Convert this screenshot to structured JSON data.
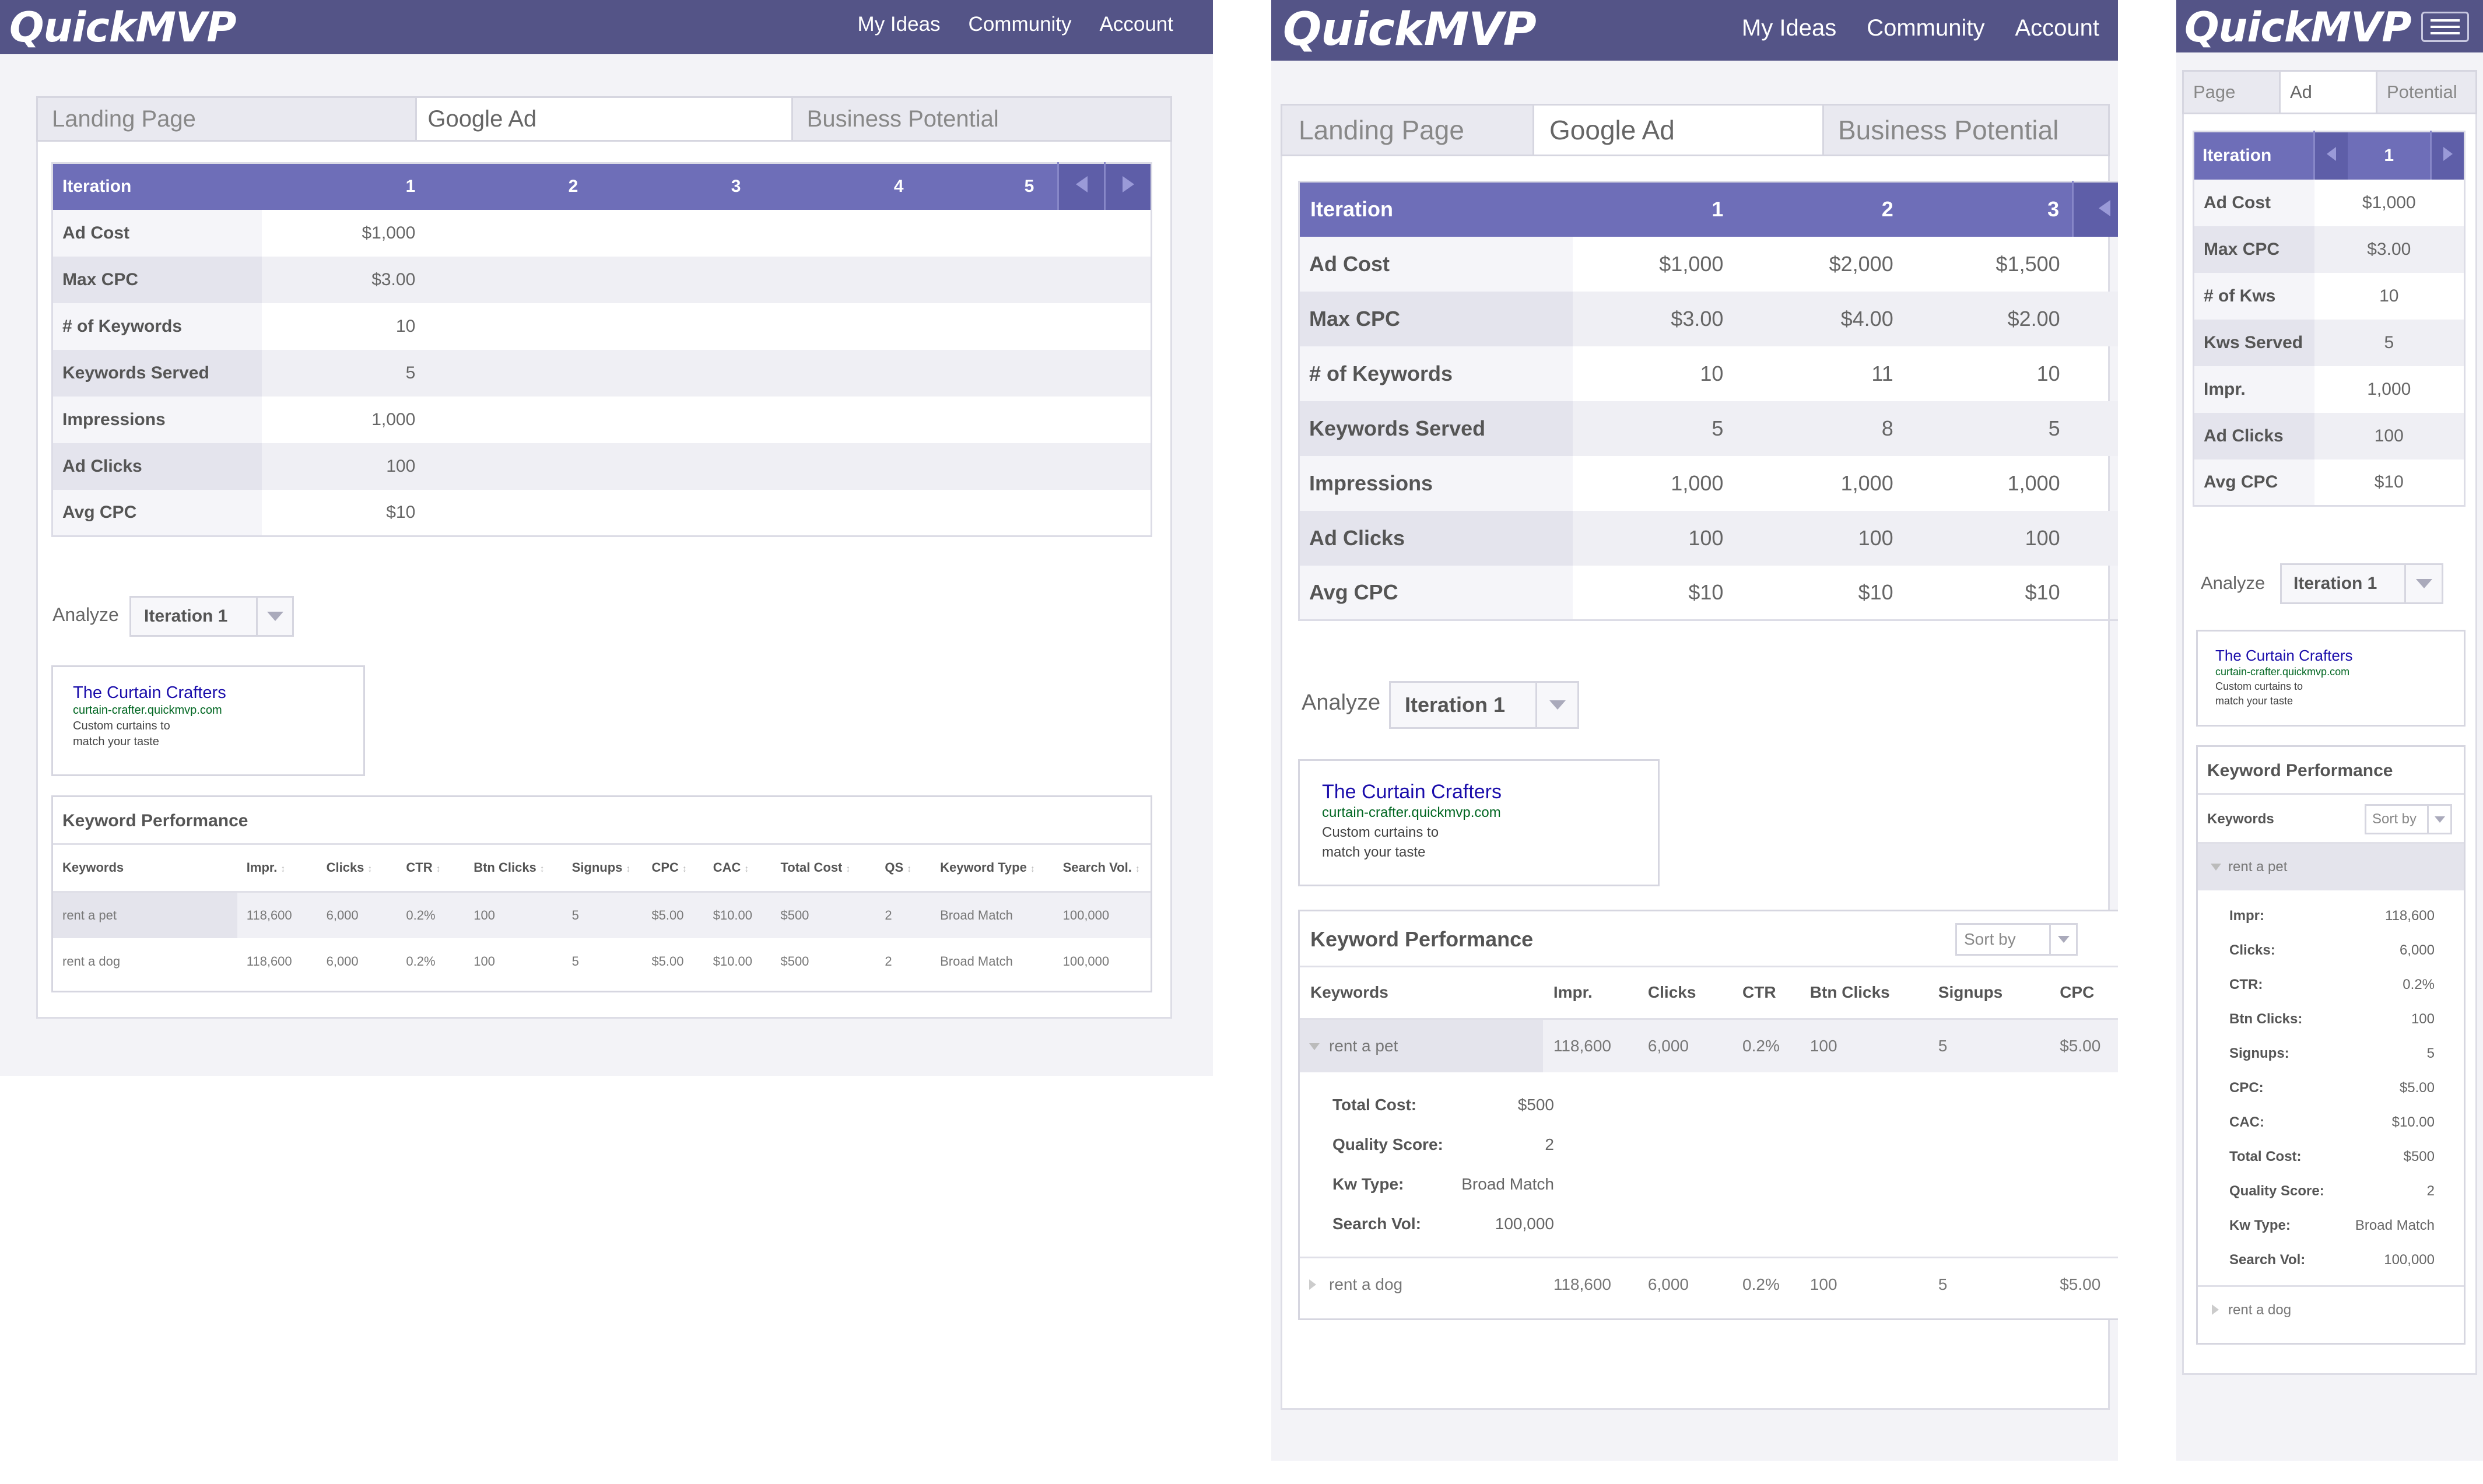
{
  "app": {
    "logo": "QuickMVP",
    "nav": [
      "My Ideas",
      "Community",
      "Account"
    ]
  },
  "tabs": {
    "full": [
      "Landing Page",
      "Google Ad",
      "Business Potential"
    ],
    "mobile": [
      "Page",
      "Ad",
      "Potential"
    ]
  },
  "iteration_table": {
    "header": "Iteration",
    "rows_full": [
      "Ad Cost",
      "Max CPC",
      "# of Keywords",
      "Keywords Served",
      "Impressions",
      "Ad Clicks",
      "Avg CPC"
    ],
    "rows_mobile": [
      "Ad Cost",
      "Max CPC",
      "# of Kws",
      "Kws Served",
      "Impr.",
      "Ad Clicks",
      "Avg CPC"
    ],
    "iterations": [
      {
        "num": "1",
        "values": [
          "$1,000",
          "$3.00",
          "10",
          "5",
          "1,000",
          "100",
          "$10"
        ]
      },
      {
        "num": "2",
        "values": [
          "$2,000",
          "$4.00",
          "11",
          "8",
          "1,000",
          "100",
          "$10"
        ]
      },
      {
        "num": "3",
        "values": [
          "$1,500",
          "$2.00",
          "10",
          "5",
          "1,000",
          "100",
          "$10"
        ]
      },
      {
        "num": "4",
        "values": []
      },
      {
        "num": "5",
        "values": []
      }
    ]
  },
  "analyze": {
    "label": "Analyze",
    "selected": "Iteration 1"
  },
  "ad_preview": {
    "title": "The Curtain Crafters",
    "url": "curtain-crafter.quickmvp.com",
    "line1": "Custom curtains to",
    "line2": "match your taste"
  },
  "keyword_performance": {
    "title": "Keyword Performance",
    "sort_by": "Sort by",
    "keywords_label": "Keywords",
    "columns": [
      "Keywords",
      "Impr.",
      "Clicks",
      "CTR",
      "Btn Clicks",
      "Signups",
      "CPC",
      "CAC",
      "Total Cost",
      "QS",
      "Keyword Type",
      "Search Vol."
    ],
    "rows": [
      [
        "rent a pet",
        "118,600",
        "6,000",
        "0.2%",
        "100",
        "5",
        "$5.00",
        "$10.00",
        "$500",
        "2",
        "Broad Match",
        "100,000"
      ],
      [
        "rent a dog",
        "118,600",
        "6,000",
        "0.2%",
        "100",
        "5",
        "$5.00",
        "$10.00",
        "$500",
        "2",
        "Broad Match",
        "100,000"
      ]
    ],
    "detail_tablet": [
      [
        "Total Cost:",
        "$500"
      ],
      [
        "Quality Score:",
        "2"
      ],
      [
        "Kw Type:",
        "Broad Match"
      ],
      [
        "Search Vol:",
        "100,000"
      ]
    ],
    "detail_mobile": [
      [
        "Impr:",
        "118,600"
      ],
      [
        "Clicks:",
        "6,000"
      ],
      [
        "CTR:",
        "0.2%"
      ],
      [
        "Btn Clicks:",
        "100"
      ],
      [
        "Signups:",
        "5"
      ],
      [
        "CPC:",
        "$5.00"
      ],
      [
        "CAC:",
        "$10.00"
      ],
      [
        "Total Cost:",
        "$500"
      ],
      [
        "Quality Score:",
        "2"
      ],
      [
        "Kw Type:",
        "Broad Match"
      ],
      [
        "Search Vol:",
        "100,000"
      ]
    ]
  },
  "colors": {
    "nav": "#545487",
    "header": "#6e6eb8",
    "link": "#1a0dab",
    "url": "#006621"
  }
}
